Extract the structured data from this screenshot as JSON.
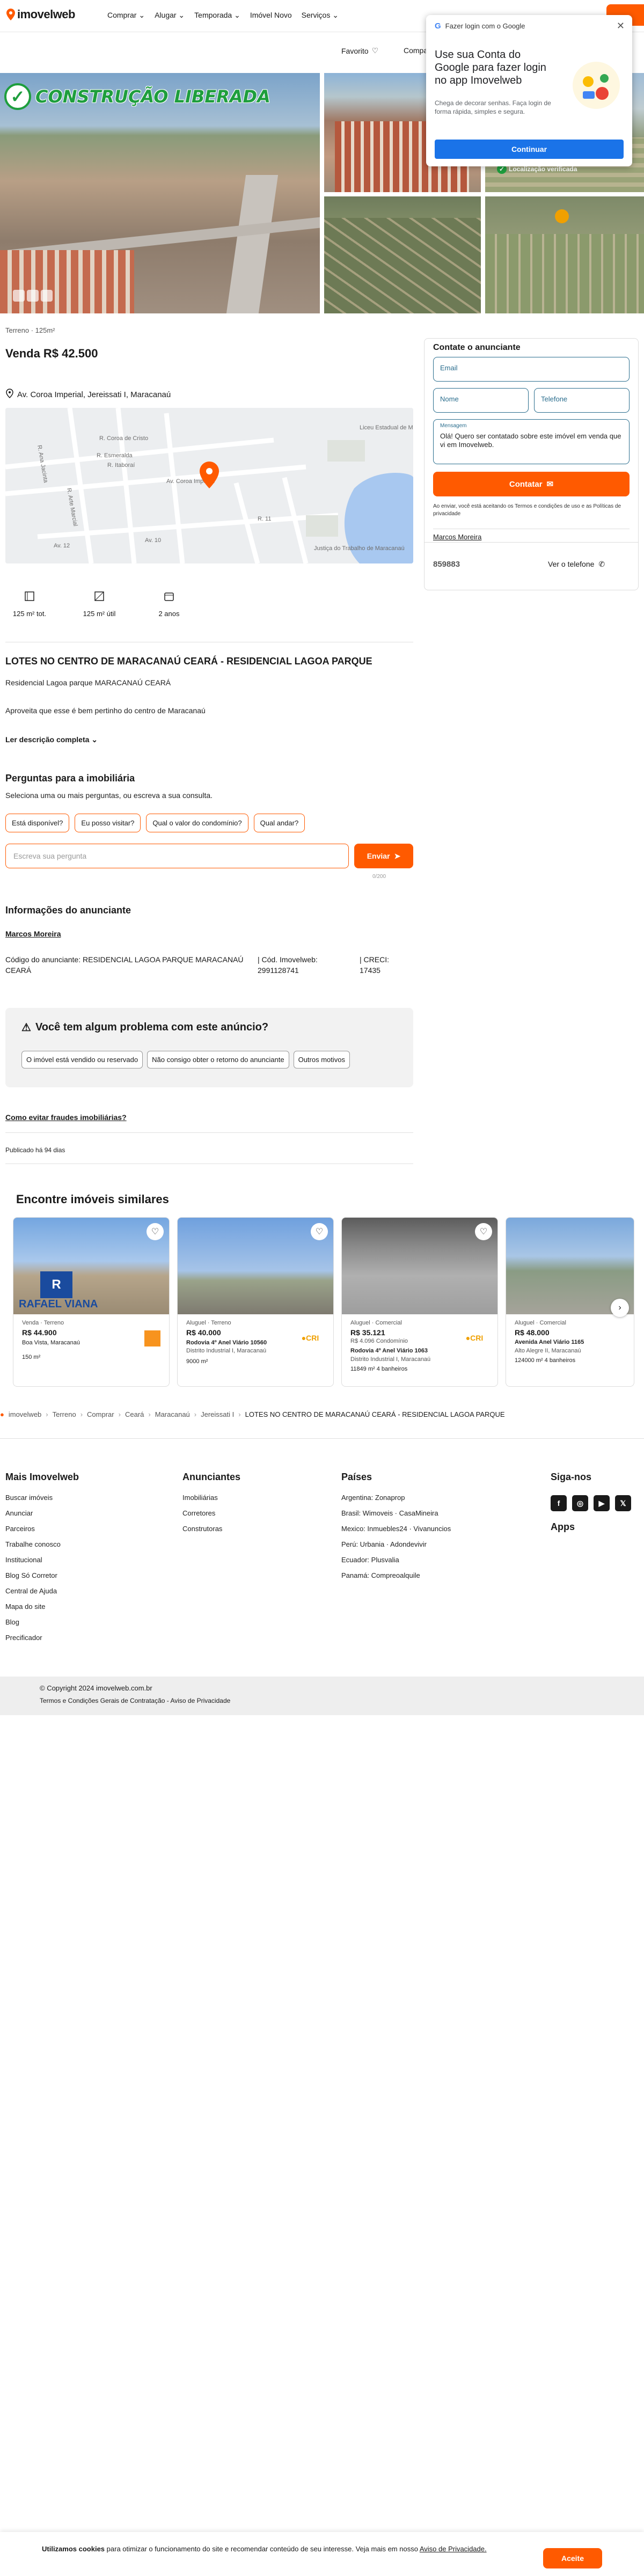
{
  "header": {
    "logo": "imovelweb",
    "nav": [
      "Comprar ⌄",
      "Alugar ⌄",
      "Temporada ⌄",
      "Imóvel Novo",
      "Serviços ⌄"
    ],
    "favorite": "Favorito",
    "compare": "Compa"
  },
  "gallery": {
    "banner": "CONSTRUÇÃO LIBERADA",
    "verified": "Localização verificada"
  },
  "listing": {
    "crumb": "Terreno · 125m²",
    "price": "Venda R$ 42.500",
    "address": "Av. Coroa Imperial, Jereissati I, Maracanaú",
    "map_labels": [
      "R. Coroa de Cristo",
      "R. Esmeralda",
      "R. Itaboraí",
      "Liceu Estadual de Maracanaú",
      "R. Ana Jacinta",
      "R. Arte Marcial",
      "Av. Coroa Imperial",
      "Av. 10",
      "R. 11",
      "Av. 12",
      "Justiça do Trabalho de Maracanaú"
    ],
    "features": [
      {
        "icon": "area-total-icon",
        "label": "125 m² tot."
      },
      {
        "icon": "area-util-icon",
        "label": "125 m² útil"
      },
      {
        "icon": "calendar-icon",
        "label": "2 anos"
      }
    ],
    "title": "LOTES NO CENTRO DE MARACANAÚ CEARÁ - RESIDENCIAL LAGOA PARQUE",
    "desc1": "Residencial Lagoa parque MARACANAÚ CEARÁ",
    "desc2": "Aproveita que esse é bem pertinho do centro de Maracanaú",
    "read_more": "Ler descrição completa ⌄"
  },
  "questions": {
    "title": "Perguntas para a imobiliária",
    "subtitle": "Seleciona uma ou mais perguntas, ou escreva a sua consulta.",
    "chips": [
      "Está disponível?",
      "Eu posso visitar?",
      "Qual o valor do condomínio?",
      "Qual andar?"
    ],
    "placeholder": "Escreva sua pergunta",
    "send": "Enviar",
    "counter": "0/200"
  },
  "advertiser": {
    "title": "Informações do anunciante",
    "name": "Marcos Moreira",
    "code": "Código do anunciante: RESIDENCIAL LAGOA PARQUE MARACANAÚ CEARÁ",
    "imovelweb_code": "| Cód. Imovelweb: 2991128741",
    "creci": "| CRECI: 17435"
  },
  "problem": {
    "title": "Você tem algum problema com este anúncio?",
    "options": [
      "O imóvel está vendido ou reservado",
      "Não consigo obter o retorno do anunciante",
      "Outros motivos"
    ],
    "fraud": "Como evitar fraudes imobiliárias?",
    "published": "Publicado há 94 dias"
  },
  "contact": {
    "title": "Contate o anunciante",
    "email": "Email",
    "name": "Nome",
    "phone": "Telefone",
    "message_label": "Mensagem",
    "message": "Olá! Quero ser contatado sobre este imóvel em venda que vi em Imovelweb.",
    "button": "Contatar",
    "terms": "Ao enviar, você está aceitando os Termos e condições de uso e as Políticas de privacidade",
    "agent": "Marcos Moreira",
    "phone_masked": "859883",
    "see_phone": "Ver o telefone"
  },
  "google": {
    "header": "Fazer login com o Google",
    "title": "Use sua Conta do Google para fazer login no app Imovelweb",
    "desc": "Chega de decorar senhas. Faça login de forma rápida, simples e segura.",
    "button": "Continuar"
  },
  "similar": {
    "title": "Encontre imóveis similares",
    "cards": [
      {
        "kind": "Venda · Terreno",
        "price": "R$ 44.900",
        "addr": "Boa Vista, Maracanaú",
        "specs": "150 m²"
      },
      {
        "kind": "Aluguel · Terreno",
        "price": "R$ 40.000",
        "addr": "Rodovia 4º Anel Viário 10560",
        "addr2": "Distrito Industrial I, Maracanaú",
        "specs": "9000 m²"
      },
      {
        "kind": "Aluguel · Comercial",
        "price": "R$ 35.121",
        "sub": "R$ 4.096 Condomínio",
        "addr": "Rodovia 4º Anel Viário 1063",
        "addr2": "Distrito Industrial I, Maracanaú",
        "specs": "11849 m²   4 banheiros"
      },
      {
        "kind": "Aluguel · Comercial",
        "price": "R$ 48.000",
        "addr": "Avenida Anel Viário 1165",
        "addr2": "Alto Alegre II, Maracanaú",
        "specs": "124000 m²   4 banheiros"
      }
    ],
    "logo_text": "RAFAEL VIANA"
  },
  "breadcrumb": [
    "imovelweb",
    "Terreno",
    "Comprar",
    "Ceará",
    "Maracanaú",
    "Jereissati I",
    "LOTES NO CENTRO DE MARACANAÚ CEARÁ - RESIDENCIAL LAGOA PARQUE"
  ],
  "footer": {
    "col1": {
      "title": "Mais Imovelweb",
      "items": [
        "Buscar imóveis",
        "Anunciar",
        "Parceiros",
        "Trabalhe conosco",
        "Institucional",
        "Blog Só Corretor",
        "Central de Ajuda",
        "Mapa do site",
        "Blog",
        "Precificador"
      ]
    },
    "col2": {
      "title": "Anunciantes",
      "items": [
        "Imobiliárias",
        "Corretores",
        "Construtoras"
      ]
    },
    "col3": {
      "title": "Países",
      "items": [
        "Argentina: Zonaprop",
        "Brasil: Wimoveis · CasaMineira",
        "Mexico: Inmuebles24 · Vivanuncios",
        "Perú: Urbania · Adondevivir",
        "Ecuador: Plusvalia",
        "Panamá: Compreoalquile"
      ]
    },
    "col4": {
      "title": "Siga-nos",
      "apps": "Apps"
    },
    "copyright": "© Copyright 2024 imovelweb.com.br",
    "legal": "Termos e Condições Gerais de Contratação - Aviso de Privacidade"
  },
  "cookie": {
    "text_bold": "Utilizamos cookies",
    "text": " para otimizar o funcionamento do site e recomendar conteúdo de seu interesse. Veja mais em nosso ",
    "link": "Aviso de Privacidade.",
    "button": "Aceite"
  },
  "colors": {
    "accent": "#ff5a00",
    "green": "#1e9e3d",
    "google_blue": "#1a73e8"
  }
}
